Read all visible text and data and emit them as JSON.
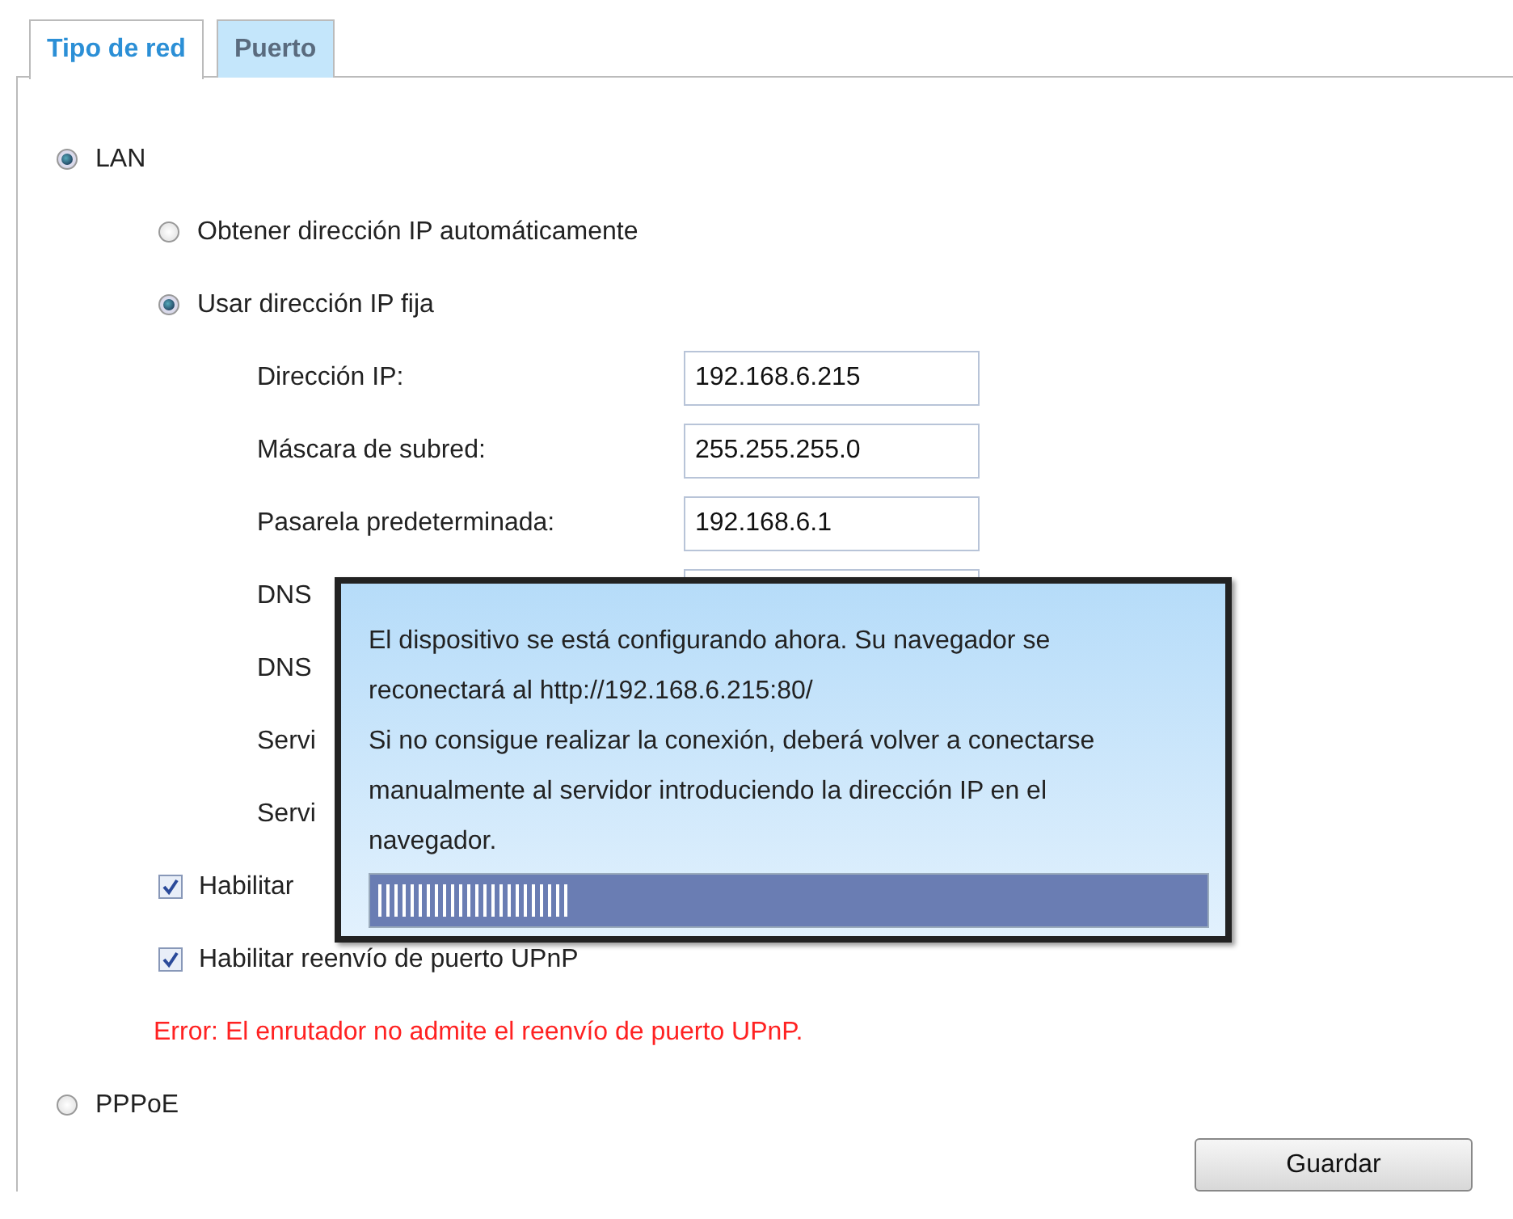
{
  "tabs": [
    {
      "label": "Tipo de red",
      "selected": true
    },
    {
      "label": "Puerto",
      "selected": false
    }
  ],
  "connection_types": [
    {
      "label": "LAN",
      "selected": true,
      "ip_modes": [
        {
          "label": "Obtener dirección IP automáticamente",
          "selected": false
        },
        {
          "label": "Usar dirección IP fija",
          "selected": true
        }
      ],
      "fields": [
        {
          "kind": "input",
          "label": "Dirección IP:",
          "value": "192.168.6.215"
        },
        {
          "kind": "input",
          "label": "Máscara de subred:",
          "value": "255.255.255.0"
        },
        {
          "kind": "input",
          "label": "Pasarela predeterminada:",
          "value": "192.168.6.1"
        },
        {
          "kind": "input",
          "label": "DNS"
        },
        {
          "kind": "label",
          "label": "DNS"
        },
        {
          "kind": "label",
          "label": "Servi"
        },
        {
          "kind": "label",
          "label": "Servi"
        }
      ],
      "checkboxes": [
        {
          "label": "Habilitar",
          "checked": true
        },
        {
          "label": "Habilitar reenvío de puerto UPnP",
          "checked": true
        }
      ],
      "error": "Error: El enrutador no admite el reenvío de puerto UPnP."
    },
    {
      "label": "PPPoE",
      "selected": false
    }
  ],
  "save_button": "Guardar",
  "dialog": {
    "paragraphs": [
      "El dispositivo se está configurando ahora. Su navegador se reconectará al http://192.168.6.215:80/",
      "Si no consigue realizar la conexión, deberá volver a conectarse manualmente al servidor introduciendo la dirección IP en el navegador."
    ],
    "progress": {
      "level": 0.23
    }
  }
}
